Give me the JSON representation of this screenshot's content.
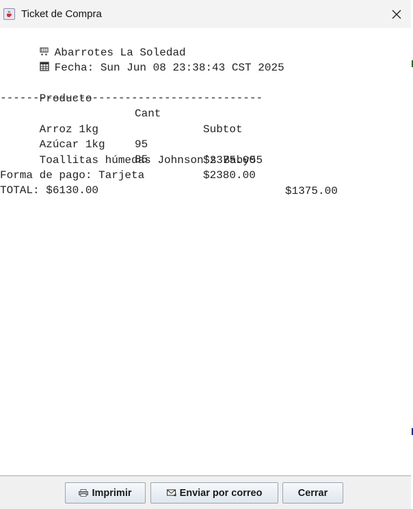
{
  "window": {
    "title": "Ticket de Compra",
    "close_label": "×"
  },
  "ticket": {
    "store_name": "Abarrotes La Soledad",
    "date_line": "Fecha: Sun Jun 08 23:38:43 CST 2025",
    "header": {
      "product": "Producto",
      "qty": "Cant",
      "subtotal": "Subtot"
    },
    "separator": "----------------------------------------",
    "items": [
      {
        "product": "Arroz 1kg",
        "qty": "95",
        "subtotal": "$2375.00"
      },
      {
        "product": "Azúcar 1kg",
        "qty": "85",
        "subtotal": "$2380.00"
      },
      {
        "product": "Toallitas húmedas Johnson’s Baby55",
        "qty": "",
        "subtotal": "$1375.00"
      }
    ],
    "payment_line": "Forma de pago: Tarjeta",
    "total_line": "TOTAL: $6130.00"
  },
  "buttons": {
    "print_label": "Imprimir",
    "email_label": "Enviar por correo",
    "close_label": "Cerrar"
  },
  "icons": {
    "app": "java-cup-icon",
    "store": "cart-icon",
    "date": "calendar-icon",
    "print": "printer-icon",
    "email": "envelope-icon",
    "close": "close-icon"
  }
}
